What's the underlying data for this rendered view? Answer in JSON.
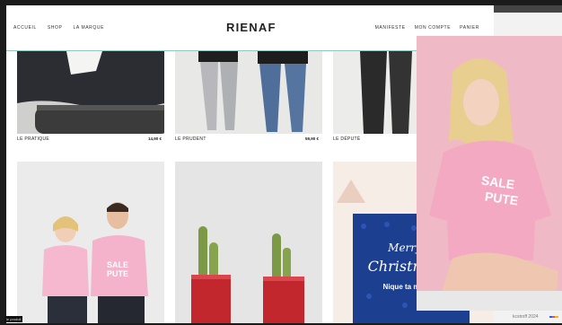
{
  "nav": {
    "left": [
      "ACCUEIL",
      "SHOP",
      "LA MARQUE"
    ],
    "logo": "RIENAF",
    "right": [
      "MANIFESTE",
      "MON COMPTE",
      "PANIER"
    ]
  },
  "products_top": [
    {
      "name": "LE PRATIQUE",
      "price": "14,90 €"
    },
    {
      "name": "LE PRUDENT",
      "price": "59,90 €"
    },
    {
      "name": "LE DÉPUTÉ",
      "price": ""
    }
  ],
  "tshirt_text": [
    "SALE",
    "PUTE"
  ],
  "card": {
    "line1": "Merry",
    "line2": "Christmas",
    "line3": "Nique ta mère"
  },
  "overlay": {
    "caption": "kcstroff 2024",
    "corner_tag": "le produit"
  },
  "colors": {
    "accent_line": "#8fc8bf",
    "pink_bg": "#efb9c6",
    "card_blue": "#1d3f8f",
    "tin_red": "#c1272d"
  }
}
